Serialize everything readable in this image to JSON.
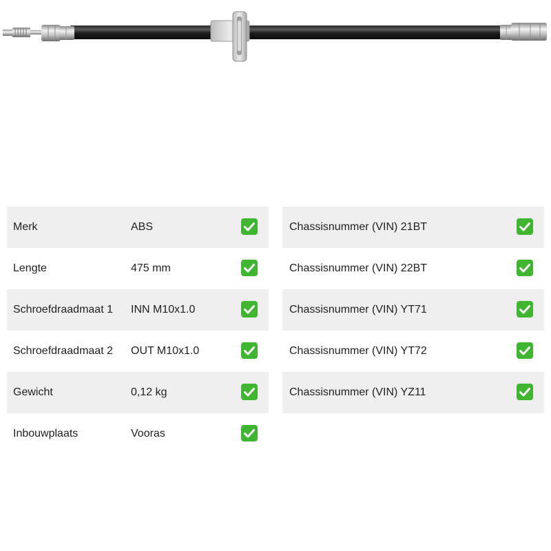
{
  "image": {
    "icon": "brake-hose-image"
  },
  "colors": {
    "row_shaded": "#efefef",
    "row_plain": "#ffffff",
    "check_green": "#3fb532",
    "text": "#222222"
  },
  "specs_left": [
    {
      "label": "Merk",
      "value": "ABS",
      "icon": "check-icon"
    },
    {
      "label": "Lengte",
      "value": "475 mm",
      "icon": "check-icon"
    },
    {
      "label": "Schroefdraadmaat 1",
      "value": "INN M10x1.0",
      "icon": "check-icon"
    },
    {
      "label": "Schroefdraadmaat 2",
      "value": "OUT M10x1.0",
      "icon": "check-icon"
    },
    {
      "label": "Gewicht",
      "value": "0,12 kg",
      "icon": "check-icon"
    },
    {
      "label": "Inbouwplaats",
      "value": "Vooras",
      "icon": "check-icon"
    }
  ],
  "specs_right": [
    {
      "text": "Chassisnummer (VIN) 21BT",
      "icon": "check-icon"
    },
    {
      "text": "Chassisnummer (VIN) 22BT",
      "icon": "check-icon"
    },
    {
      "text": "Chassisnummer (VIN) YT71",
      "icon": "check-icon"
    },
    {
      "text": "Chassisnummer (VIN) YT72",
      "icon": "check-icon"
    },
    {
      "text": "Chassisnummer (VIN) YZ11",
      "icon": "check-icon"
    }
  ]
}
